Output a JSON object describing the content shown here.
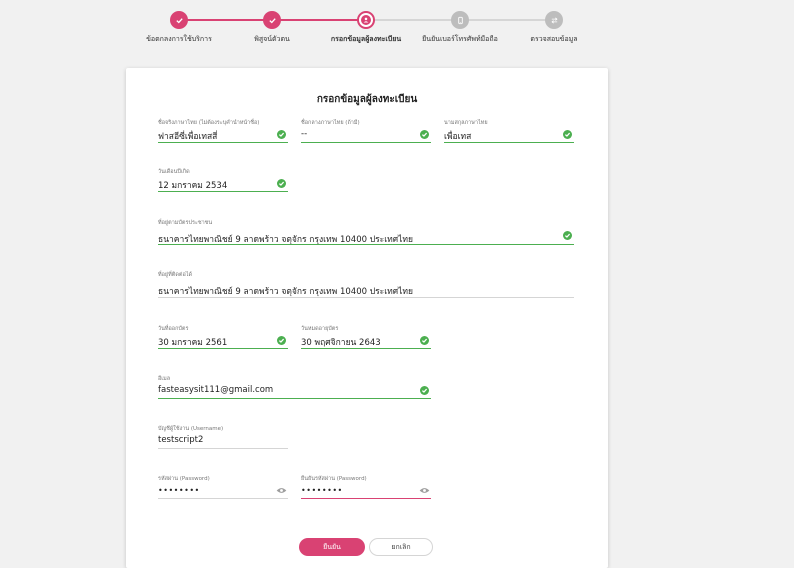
{
  "stepper": {
    "steps": [
      {
        "label": "ข้อตกลงการใช้บริการ",
        "state": "done",
        "icon": "check-icon"
      },
      {
        "label": "พิสูจน์ตัวตน",
        "state": "done",
        "icon": "check-icon"
      },
      {
        "label": "กรอกข้อมูลผู้ลงทะเบียน",
        "state": "active",
        "icon": "user-icon"
      },
      {
        "label": "ยืนยันเบอร์โทรศัพท์มือถือ",
        "state": "pending",
        "icon": "phone-icon"
      },
      {
        "label": "ตรวจสอบข้อมูล",
        "state": "pending",
        "icon": "transfer-icon"
      }
    ]
  },
  "form": {
    "title": "กรอกข้อมูลผู้ลงทะเบียน",
    "first_name": {
      "label": "ชื่อจริงภาษาไทย (ไม่ต้องระบุคำนำหน้าชื่อ)",
      "value": "ฟาสอีซี่เพื่อเทสสี่"
    },
    "middle_name": {
      "label": "ชื่อกลางภาษาไทย (ถ้ามี)",
      "value": "--"
    },
    "last_name": {
      "label": "นามสกุลภาษาไทย",
      "value": "เพื่อเทส"
    },
    "birth_date": {
      "label": "วันเดือนปีเกิด",
      "value": "12 มกราคม 2534"
    },
    "id_address": {
      "label": "ที่อยู่ตามบัตรประชาชน",
      "value": "ธนาคารไทยพาณิชย์  9 ลาดพร้าว จตุจักร กรุงเทพ 10400 ประเทศไทย"
    },
    "contact_address": {
      "label": "ที่อยู่ที่ติดต่อได้",
      "value": "ธนาคารไทยพาณิชย์  9 ลาดพร้าว จตุจักร กรุงเทพ 10400 ประเทศไทย"
    },
    "issue_date": {
      "label": "วันที่ออกบัตร",
      "value": "30 มกราคม 2561"
    },
    "expiry_date": {
      "label": "วันหมดอายุบัตร",
      "value": "30 พฤศจิกายน 2643"
    },
    "email": {
      "label": "อีเมล",
      "value": "fasteasysit111@gmail.com"
    },
    "username": {
      "label": "บัญชีผู้ใช้งาน (Username)",
      "value": "testscript2"
    },
    "password": {
      "label": "รหัสผ่าน (Password)",
      "value": "••••••••"
    },
    "confirm_password": {
      "label": "ยืนยันรหัสผ่าน (Password)",
      "value": "••••••••"
    },
    "confirm_button": "ยืนยัน",
    "cancel_button": "ยกเลิก"
  },
  "colors": {
    "accent": "#d94273",
    "success": "#4caf50",
    "pending": "#bdbdbd"
  }
}
